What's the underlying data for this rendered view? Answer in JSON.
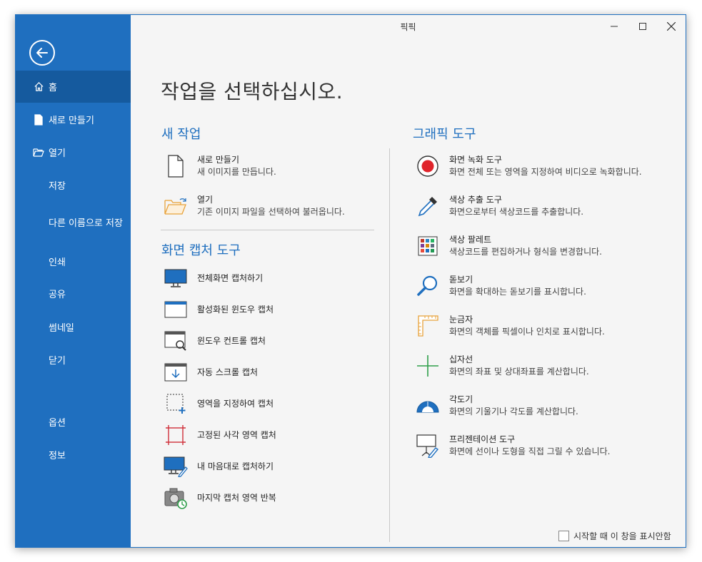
{
  "window": {
    "title": "픽픽"
  },
  "sidebar": {
    "items": [
      {
        "label": "홈",
        "icon": "home-icon",
        "active": true
      },
      {
        "label": "새로 만들기",
        "icon": "new-file-icon"
      },
      {
        "label": "열기",
        "icon": "open-folder-icon"
      },
      {
        "label": "저장"
      },
      {
        "label": "다른 이름으로 저장"
      },
      {
        "label": "인쇄"
      },
      {
        "label": "공유"
      },
      {
        "label": "썸네일"
      },
      {
        "label": "닫기"
      },
      {
        "label": "옵션"
      },
      {
        "label": "정보"
      }
    ]
  },
  "main": {
    "heading": "작업을 선택하십시오.",
    "new_task": {
      "title": "새 작업",
      "items": [
        {
          "title": "새로 만들기",
          "desc": "새 이미지를 만듭니다.",
          "icon": "new-document-icon"
        },
        {
          "title": "열기",
          "desc": "기존 이미지 파일을 선택하여 불러옵니다.",
          "icon": "open-folder-icon"
        }
      ]
    },
    "capture": {
      "title": "화면 캡처 도구",
      "items": [
        {
          "title": "전체화면 캡처하기",
          "icon": "fullscreen-capture-icon"
        },
        {
          "title": "활성화된 윈도우 캡처",
          "icon": "active-window-capture-icon"
        },
        {
          "title": "윈도우 컨트롤 캡처",
          "icon": "window-control-capture-icon"
        },
        {
          "title": "자동 스크롤 캡처",
          "icon": "scroll-capture-icon"
        },
        {
          "title": "영역을 지정하여 캡처",
          "icon": "region-capture-icon"
        },
        {
          "title": "고정된 사각 영역 캡처",
          "icon": "fixed-region-capture-icon"
        },
        {
          "title": "내 마음대로 캡처하기",
          "icon": "freehand-capture-icon"
        },
        {
          "title": "마지막 캡처 영역 반복",
          "icon": "repeat-capture-icon"
        }
      ]
    },
    "graphic": {
      "title": "그래픽 도구",
      "items": [
        {
          "title": "화면 녹화 도구",
          "desc": "화면 전체 또는 영역을 지정하여 비디오로 녹화합니다.",
          "icon": "record-icon"
        },
        {
          "title": "색상 추출 도구",
          "desc": "화면으로부터 색상코드를 추출합니다.",
          "icon": "eyedropper-icon"
        },
        {
          "title": "색상 팔레트",
          "desc": "색상코드를 편집하거나 형식을 변경합니다.",
          "icon": "palette-icon"
        },
        {
          "title": "돋보기",
          "desc": "화면을 확대하는 돋보기를 표시합니다.",
          "icon": "magnifier-icon"
        },
        {
          "title": "눈금자",
          "desc": "화면의 객체를 픽셀이나 인치로 표시합니다.",
          "icon": "ruler-icon"
        },
        {
          "title": "십자선",
          "desc": "화면의 좌표 및 상대좌표를 계산합니다.",
          "icon": "crosshair-icon"
        },
        {
          "title": "각도기",
          "desc": "화면의 기울기나 각도를 계산합니다.",
          "icon": "protractor-icon"
        },
        {
          "title": "프리젠테이션 도구",
          "desc": "화면에 선이나 도형을 직접 그릴 수 있습니다.",
          "icon": "presentation-icon"
        }
      ]
    },
    "startup_label": "시작할 때 이 창을 표시안함"
  },
  "colors": {
    "accent": "#1f6fbf",
    "active": "#155a9e",
    "record": "#e0242b"
  }
}
